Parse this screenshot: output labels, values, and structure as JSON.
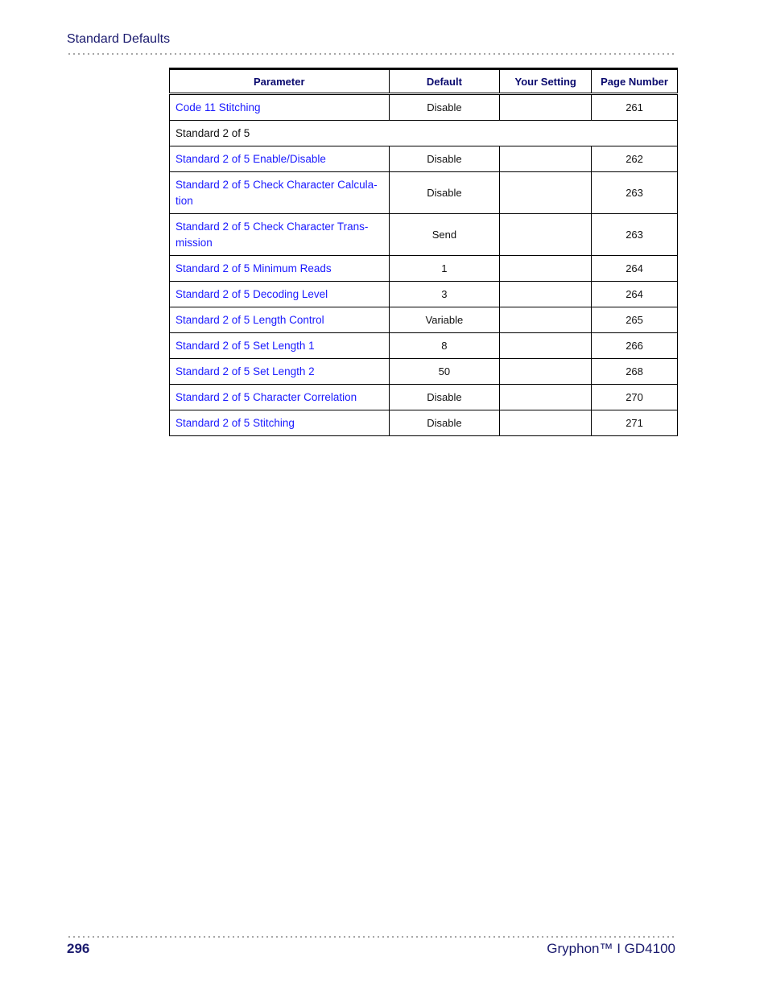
{
  "header": {
    "running_head": "Standard Defaults"
  },
  "table": {
    "columns": [
      "Parameter",
      "Default",
      "Your Setting",
      "Page Number"
    ],
    "rows": [
      {
        "type": "param",
        "parameter": "Code 11 Stitching",
        "default": "Disable",
        "your_setting": "",
        "page": "261"
      },
      {
        "type": "section",
        "parameter": "Standard 2 of 5"
      },
      {
        "type": "param",
        "parameter": "Standard 2 of 5 Enable/Disable",
        "default": "Disable",
        "your_setting": "",
        "page": "262"
      },
      {
        "type": "param",
        "parameter": "Standard 2 of 5 Check Character Calcula-tion",
        "default": "Disable",
        "your_setting": "",
        "page": "263"
      },
      {
        "type": "param",
        "parameter": "Standard 2 of 5 Check Character Trans-mission",
        "default": "Send",
        "your_setting": "",
        "page": "263"
      },
      {
        "type": "param",
        "parameter": "Standard 2 of 5 Minimum Reads",
        "default": "1",
        "your_setting": "",
        "page": "264"
      },
      {
        "type": "param",
        "parameter": "Standard 2 of 5 Decoding Level",
        "default": "3",
        "your_setting": "",
        "page": "264"
      },
      {
        "type": "param",
        "parameter": "Standard 2 of 5 Length Control",
        "default": "Variable",
        "your_setting": "",
        "page": "265"
      },
      {
        "type": "param",
        "parameter": "Standard 2 of 5 Set Length 1",
        "default": "8",
        "your_setting": "",
        "page": "266"
      },
      {
        "type": "param",
        "parameter": "Standard 2 of 5 Set Length 2",
        "default": "50",
        "your_setting": "",
        "page": "268"
      },
      {
        "type": "param",
        "parameter": "Standard 2 of 5 Character Correlation",
        "default": "Disable",
        "your_setting": "",
        "page": "270"
      },
      {
        "type": "param",
        "parameter": "Standard 2 of 5 Stitching",
        "default": "Disable",
        "your_setting": "",
        "page": "271"
      }
    ]
  },
  "footer": {
    "page_number": "296",
    "product": "Gryphon™ I GD4100"
  },
  "colors": {
    "link": "#1a1aff",
    "heading": "#1a1a6e"
  }
}
